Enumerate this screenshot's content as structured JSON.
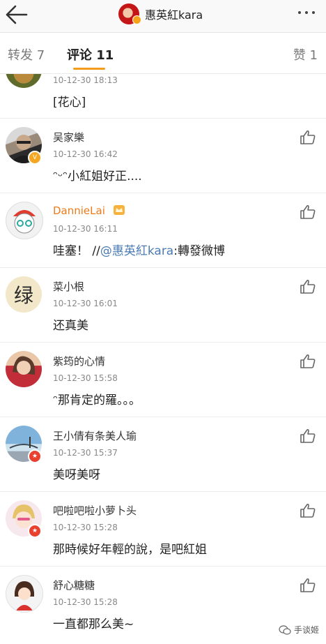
{
  "header": {
    "title": "惠英紅kara",
    "back_icon": "back-arrow-icon",
    "more_icon": "more-dots-icon"
  },
  "tabs": {
    "repost": "转发 7",
    "comment": "评论 11",
    "like": "赞 1",
    "accent": "#f49c1c"
  },
  "comments": [
    {
      "name": "",
      "time": "10-12-30 18:13",
      "text": "[花心]"
    },
    {
      "name": "吴家樂",
      "time": "10-12-30 16:42",
      "text": "ᵔᵕᵔ小紅姐好正...."
    },
    {
      "name": "DannieLai",
      "time": "10-12-30 16:11",
      "text_prefix": "哇塞！ //",
      "mention": "@惠英紅kara",
      "text_suffix": ":轉發微博"
    },
    {
      "name": "菜小根",
      "time": "10-12-30 16:01",
      "text": "还真美",
      "avatar_text": "绿"
    },
    {
      "name": "紫筠的心情",
      "time": "10-12-30 15:58",
      "text": "ᵔ那肯定的羅。。。"
    },
    {
      "name": "王小倩有条美人瑜",
      "time": "10-12-30 15:37",
      "text": "美呀美呀"
    },
    {
      "name": "吧啦吧啦小萝卜头",
      "time": "10-12-30 15:28",
      "text": "那時候好年輕的說，是吧紅姐"
    },
    {
      "name": "舒心糖糖",
      "time": "10-12-30 15:28",
      "text": "一直都那么美~"
    }
  ],
  "watermark": "手谈姬",
  "colors": {
    "name_highlight": "#ee7a1b",
    "mention": "#4a7bb3",
    "badge_vip": "#f5a623",
    "badge_red": "#e9402f"
  }
}
